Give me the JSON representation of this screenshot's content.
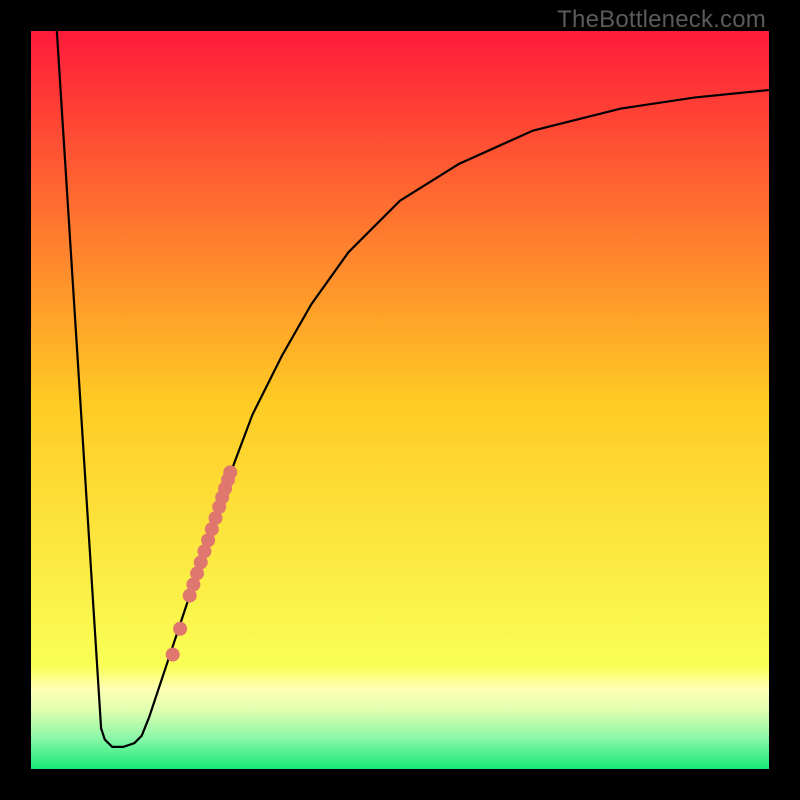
{
  "watermark": "TheBottleneck.com",
  "chart_data": {
    "type": "line",
    "title": "",
    "xlabel": "",
    "ylabel": "",
    "xlim": [
      0,
      100
    ],
    "ylim": [
      0,
      100
    ],
    "background_gradient": {
      "stops": [
        {
          "offset": 0,
          "color": "#ff1a3a"
        },
        {
          "offset": 50,
          "color": "#ffca24"
        },
        {
          "offset": 86,
          "color": "#f9ff55"
        },
        {
          "offset": 89,
          "color": "#ffffb2"
        },
        {
          "offset": 92,
          "color": "#e0ffb0"
        },
        {
          "offset": 96,
          "color": "#85f7a7"
        },
        {
          "offset": 100,
          "color": "#17e876"
        }
      ]
    },
    "series": [
      {
        "name": "bottleneck-curve",
        "type": "line",
        "color": "#000000",
        "width": 2.2,
        "points": [
          {
            "x": 3.5,
            "y": 100
          },
          {
            "x": 9.5,
            "y": 5.5
          },
          {
            "x": 10.0,
            "y": 4.0
          },
          {
            "x": 11.0,
            "y": 3.0
          },
          {
            "x": 12.5,
            "y": 3.0
          },
          {
            "x": 14.0,
            "y": 3.5
          },
          {
            "x": 15.0,
            "y": 4.5
          },
          {
            "x": 16.0,
            "y": 7.0
          },
          {
            "x": 18.0,
            "y": 13.0
          },
          {
            "x": 20.0,
            "y": 19.0
          },
          {
            "x": 22.0,
            "y": 25.0
          },
          {
            "x": 24.0,
            "y": 31.0
          },
          {
            "x": 27.0,
            "y": 40.0
          },
          {
            "x": 30.0,
            "y": 48.0
          },
          {
            "x": 34.0,
            "y": 56.0
          },
          {
            "x": 38.0,
            "y": 63.0
          },
          {
            "x": 43.0,
            "y": 70.0
          },
          {
            "x": 50.0,
            "y": 77.0
          },
          {
            "x": 58.0,
            "y": 82.0
          },
          {
            "x": 68.0,
            "y": 86.5
          },
          {
            "x": 80.0,
            "y": 89.5
          },
          {
            "x": 90.0,
            "y": 91.0
          },
          {
            "x": 100.0,
            "y": 92.0
          }
        ]
      },
      {
        "name": "highlight-dots",
        "type": "scatter",
        "color": "#e0776e",
        "radius": 7,
        "points": [
          {
            "x": 19.2,
            "y": 15.5
          },
          {
            "x": 20.2,
            "y": 19.0
          },
          {
            "x": 21.5,
            "y": 23.5
          },
          {
            "x": 22.0,
            "y": 25.0
          },
          {
            "x": 22.5,
            "y": 26.5
          },
          {
            "x": 23.0,
            "y": 28.0
          },
          {
            "x": 23.5,
            "y": 29.5
          },
          {
            "x": 24.0,
            "y": 31.0
          },
          {
            "x": 24.5,
            "y": 32.5
          },
          {
            "x": 25.0,
            "y": 34.0
          },
          {
            "x": 25.5,
            "y": 35.5
          },
          {
            "x": 25.9,
            "y": 36.8
          },
          {
            "x": 26.3,
            "y": 38.0
          },
          {
            "x": 26.7,
            "y": 39.2
          },
          {
            "x": 27.0,
            "y": 40.2
          }
        ]
      }
    ]
  }
}
